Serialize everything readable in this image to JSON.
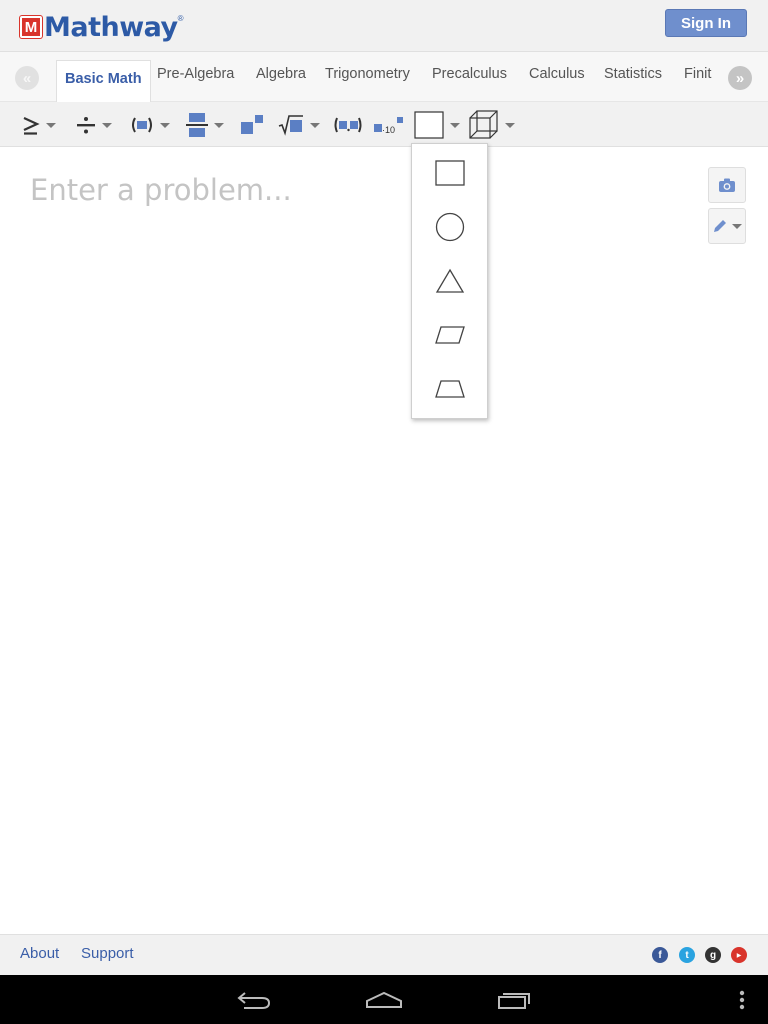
{
  "header": {
    "logo_mark": "M",
    "logo_text": "Mathway",
    "logo_tm": "®",
    "sign_in_label": "Sign In"
  },
  "tabs": {
    "items": [
      "Basic Math",
      "Pre-Algebra",
      "Algebra",
      "Trigonometry",
      "Precalculus",
      "Calculus",
      "Statistics",
      "Finit"
    ],
    "active": "Basic Math"
  },
  "toolbar": {
    "tools": [
      "inequality-icon",
      "divide-icon",
      "parentheses-icon",
      "fraction-icon",
      "exponent-icon",
      "square-root-icon",
      "ordered-pair-icon",
      "scientific-notation-icon",
      "shape-2d-icon",
      "shape-3d-icon"
    ],
    "scientific_label": "·10"
  },
  "dropdown": {
    "items": [
      "square-icon",
      "circle-icon",
      "triangle-icon",
      "parallelogram-icon",
      "trapezoid-icon"
    ]
  },
  "input": {
    "placeholder": "Enter a problem..."
  },
  "side_buttons": [
    "camera-icon",
    "pencil-icon"
  ],
  "footer": {
    "about_label": "About",
    "support_label": "Support",
    "social": [
      "facebook-icon",
      "twitter-icon",
      "google-plus-icon",
      "youtube-icon"
    ]
  },
  "colors": {
    "brand_blue": "#2d5aa6",
    "accent_blue": "#6f8fcd",
    "logo_red": "#d9342b",
    "tool_blue": "#5b7fc4"
  }
}
